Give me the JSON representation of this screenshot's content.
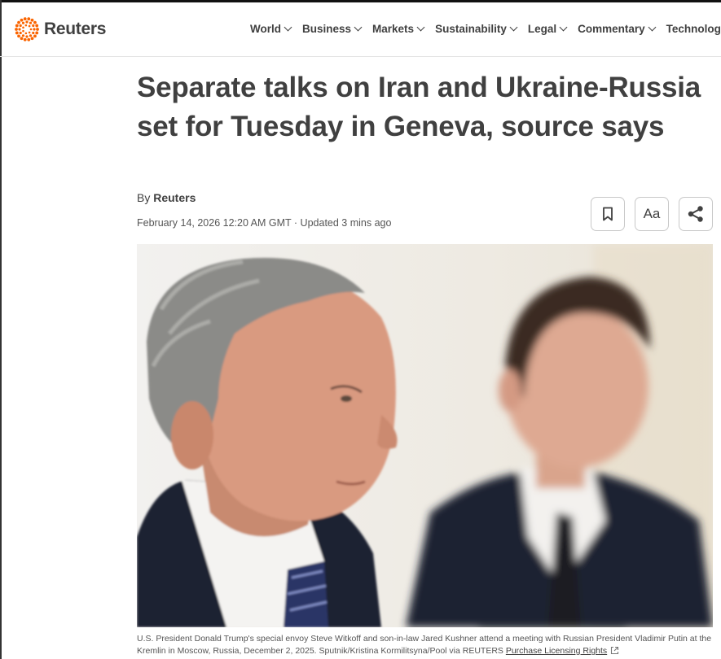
{
  "brand": {
    "name": "Reuters"
  },
  "nav": {
    "items": [
      {
        "label": "World"
      },
      {
        "label": "Business"
      },
      {
        "label": "Markets"
      },
      {
        "label": "Sustainability"
      },
      {
        "label": "Legal"
      },
      {
        "label": "Commentary"
      },
      {
        "label": "Technology"
      }
    ]
  },
  "article": {
    "headline": "Separate talks on Iran and Ukraine-Russia set for Tuesday in Geneva, source says",
    "byline_prefix": "By ",
    "author": "Reuters",
    "dateline": "February 14, 2026 12:20 AM GMT · Updated 3 mins ago",
    "font_button_label": "Aa",
    "caption_text": "U.S. President Donald Trump's special envoy Steve Witkoff and son-in-law Jared Kushner attend a meeting with Russian President Vladimir Putin at the Kremlin in Moscow, Russia, December 2, 2025. Sputnik/Kristina Kormilitsyna/Pool via REUTERS ",
    "caption_link": "Purchase Licensing Rights"
  },
  "icons": {
    "logo": "reuters-dot-ring-icon",
    "nav_dropdown": "chevron-down-icon",
    "bookmark": "bookmark-icon",
    "share": "share-icon",
    "external": "external-link-icon"
  },
  "colors": {
    "brand_orange": "#fa6400",
    "text": "#404040",
    "muted": "#555555",
    "border": "#c8c8c8"
  }
}
